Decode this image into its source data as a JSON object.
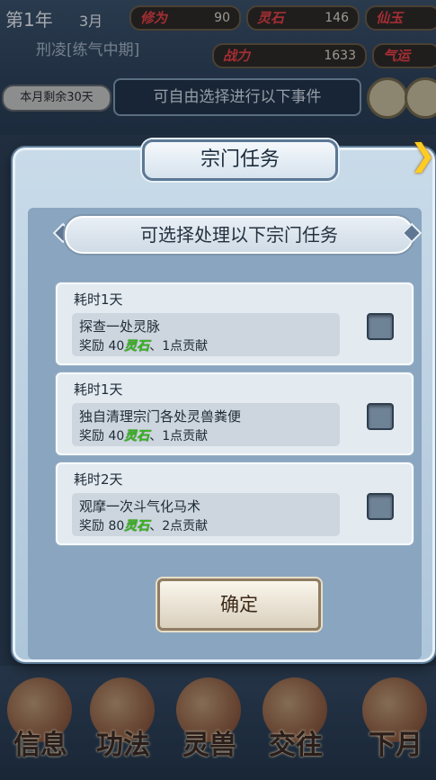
{
  "hud": {
    "year": "第1年",
    "month": "3月",
    "stats": [
      {
        "label": "修为",
        "value": "90"
      },
      {
        "label": "灵石",
        "value": "146"
      },
      {
        "label": "仙玉",
        "value": ""
      },
      {
        "label": "战力",
        "value": "1633"
      },
      {
        "label": "气运",
        "value": ""
      }
    ],
    "character": "刑凌[练气中期]",
    "days_left": "本月剩余30天",
    "event_hint": "可自由选择进行以下事件"
  },
  "dialog": {
    "title": "宗门任务",
    "subtitle": "可选择处理以下宗门任务",
    "tasks": [
      {
        "duration": "耗时1天",
        "name": "探查一处灵脉",
        "reward_prefix": "奖励 40",
        "reward_currency": "灵石",
        "reward_suffix": "、1点贡献"
      },
      {
        "duration": "耗时1天",
        "name": "独自清理宗门各处灵兽粪便",
        "reward_prefix": "奖励 40",
        "reward_currency": "灵石",
        "reward_suffix": "、1点贡献"
      },
      {
        "duration": "耗时2天",
        "name": "观摩一次斗气化马术",
        "reward_prefix": "奖励 80",
        "reward_currency": "灵石",
        "reward_suffix": "、2点贡献"
      }
    ],
    "confirm_label": "确定"
  },
  "bottom_menu": [
    "信息",
    "功法",
    "灵兽",
    "交往",
    "下月"
  ]
}
